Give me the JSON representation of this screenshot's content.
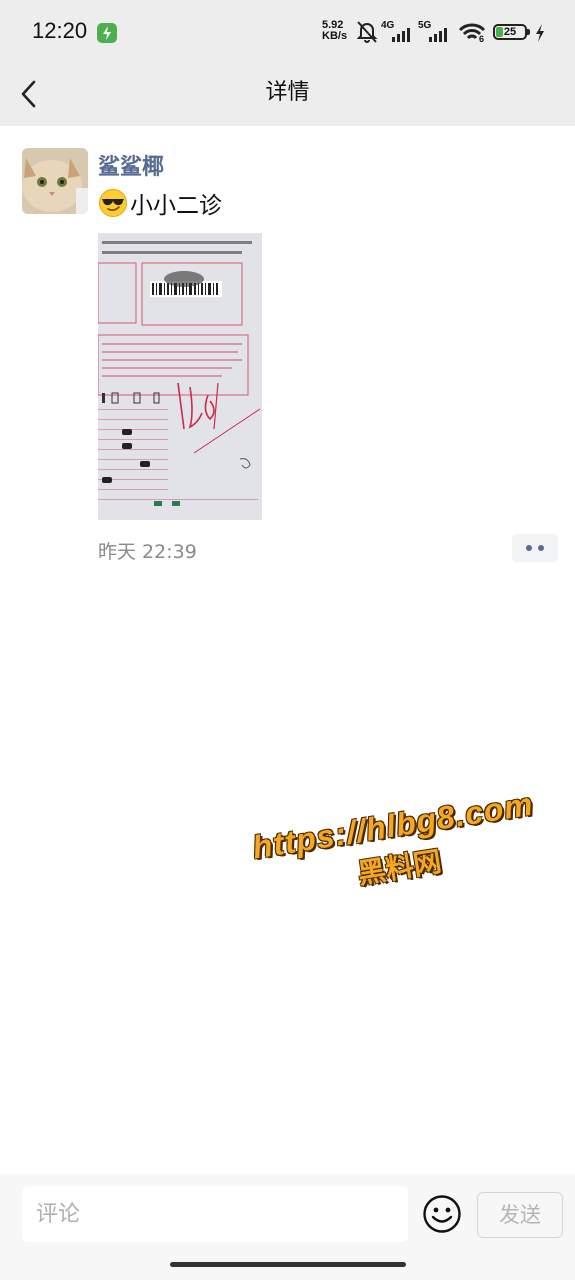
{
  "status_bar": {
    "time": "12:20",
    "net_speed_value": "5.92",
    "net_speed_unit": "KB/s",
    "network_1": "4G",
    "network_2": "5G",
    "wifi_label": "6",
    "battery_level": "25"
  },
  "header": {
    "title": "详情"
  },
  "post": {
    "username": "鲨鲨椰",
    "text": "小小二诊",
    "emoji": "smiling-face-with-sunglasses",
    "time": "昨天 22:39"
  },
  "watermark": {
    "url": "https://hlbg8.com",
    "name": "黑料网"
  },
  "comment_bar": {
    "placeholder": "评论",
    "send_label": "发送"
  },
  "colors": {
    "header_bg": "#ededed",
    "username": "#576b95",
    "battery": "#4caf50",
    "watermark": "#f5a623"
  }
}
